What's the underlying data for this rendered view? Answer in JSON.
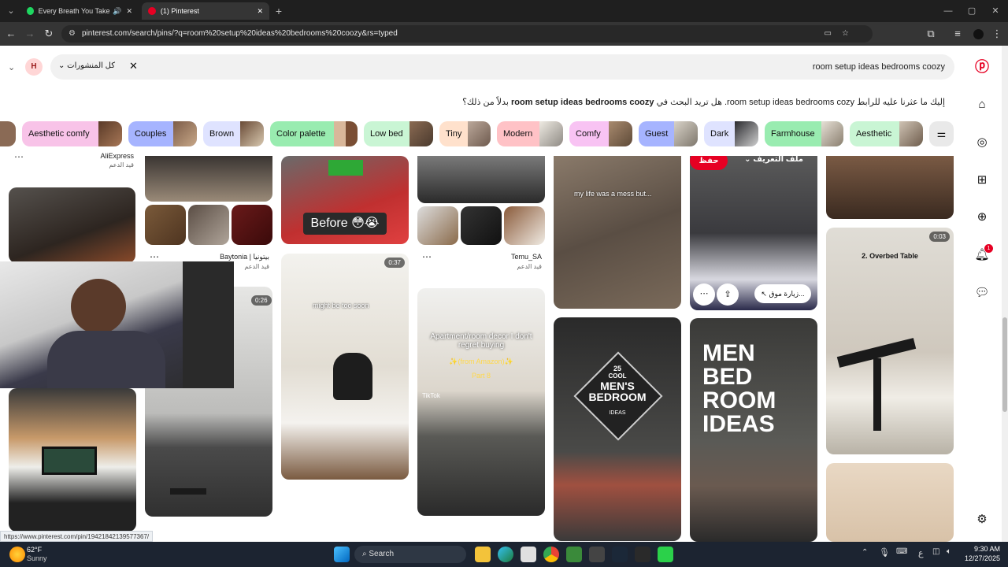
{
  "browser": {
    "tabs": [
      {
        "title": "Every Breath You Take • The"
      },
      {
        "title": "(1) Pinterest"
      }
    ],
    "url": "pinterest.com/search/pins/?q=room%20setup%20ideas%20bedrooms%20coozy&rs=typed"
  },
  "search": {
    "query": "room setup ideas bedrooms coozy",
    "filter_label": "كل المنشورات",
    "avatar_letter": "H"
  },
  "suggestion": {
    "prefix": "إليك ما عثرنا عليه للرابط",
    "typed": "room setup ideas bedrooms cozy",
    "middle": ". هل تريد البحث في",
    "bold": "room setup ideas bedrooms coozy",
    "suffix": "بدلاً من ذلك؟"
  },
  "chips": [
    {
      "label": "Aesthetic comfy",
      "bg": "#f8c3e8"
    },
    {
      "label": "Couples",
      "bg": "#a6b4ff"
    },
    {
      "label": "Brown",
      "bg": "#dfe3ff"
    },
    {
      "label": "Color palette",
      "bg": "#99ecb0"
    },
    {
      "label": "Low bed",
      "bg": "#c9f5d4"
    },
    {
      "label": "Tiny",
      "bg": "#ffe1cc"
    },
    {
      "label": "Modern",
      "bg": "#ffc2c6"
    },
    {
      "label": "Comfy",
      "bg": "#f8c3f3"
    },
    {
      "label": "Guest",
      "bg": "#a6b4ff"
    },
    {
      "label": "Dark",
      "bg": "#dfe3ff"
    },
    {
      "label": "Farmhouse",
      "bg": "#99ecb0"
    },
    {
      "label": "Aesthetic",
      "bg": "#c9f5d4"
    }
  ],
  "pins": {
    "aliexpress": {
      "source": "AliExpress",
      "note": "قيد الدعم"
    },
    "baytonia": {
      "source": "Baytonia | بيتونيا",
      "note": "قيد الدعم"
    },
    "temu": {
      "source": "Temu_SA",
      "note": "قيد الدعم"
    },
    "before": {
      "text": "Before 😳😭"
    },
    "mess": {
      "text": "my life was a mess but..."
    },
    "overlay": {
      "save": "حفظ",
      "profile": "ملف التعريف",
      "visit": "زيارة موق..."
    },
    "overbed": {
      "duration": "0:03",
      "text": "2. Overbed Table"
    },
    "sitting": {
      "duration": "0:37",
      "text": "might be too soon"
    },
    "apartment": {
      "text": "Apartment/room decor I don't regret buying",
      "sub": "✨(from Amazon)✨",
      "part": "Part 8",
      "badge": "TikTok"
    },
    "cam_pin": {
      "duration": "0:26"
    },
    "mens": {
      "count": "25",
      "cool": "COOL",
      "title": "MEN'S BEDROOM",
      "sub": "IDEAS"
    },
    "menbed": {
      "title": "MEN BED ROOM IDEAS"
    }
  },
  "status_url": "https://www.pinterest.com/pin/194218421395773​67/",
  "taskbar": {
    "temp": "62°F",
    "weather": "Sunny",
    "search": "Search",
    "time": "9:30 AM",
    "date": "12/27/2025",
    "lang": "ع"
  },
  "notif_count": "1"
}
